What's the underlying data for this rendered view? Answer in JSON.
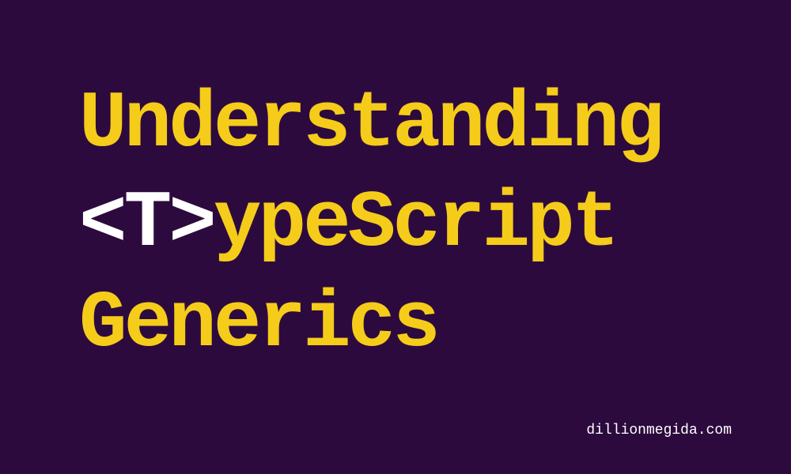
{
  "title": {
    "line1": "Understanding",
    "line2_tag": "<T>",
    "line2_rest": "ypeScript",
    "line3": "Generics"
  },
  "footer": {
    "url": "dillionmegida.com"
  },
  "colors": {
    "background": "#2d0a3e",
    "accent": "#f5cc1a",
    "tag": "#ffffff"
  }
}
